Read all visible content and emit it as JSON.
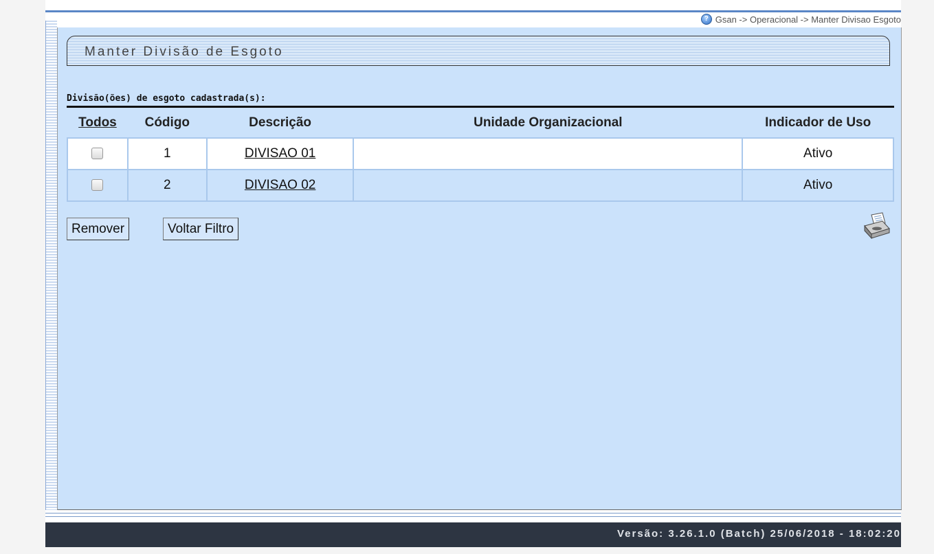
{
  "breadcrumb": "Gsan -> Operacional -> Manter Divisao Esgoto",
  "page_title": "Manter Divisão de Esgoto",
  "section_label": "Divisão(ões) de esgoto cadastrada(s):",
  "table": {
    "headers": {
      "todos": "Todos",
      "codigo": "Código",
      "descricao": "Descrição",
      "unidade": "Unidade Organizacional",
      "indicador": "Indicador de Uso"
    },
    "rows": [
      {
        "codigo": "1",
        "descricao": "DIVISAO 01",
        "unidade": "",
        "indicador": "Ativo",
        "checked": false
      },
      {
        "codigo": "2",
        "descricao": "DIVISAO 02",
        "unidade": "",
        "indicador": "Ativo",
        "checked": false
      }
    ]
  },
  "buttons": {
    "remover": "Remover",
    "voltar_filtro": "Voltar Filtro"
  },
  "icons": {
    "help": "help-icon",
    "print": "printer-icon"
  },
  "footer": "Versão: 3.26.1.0 (Batch) 25/06/2018 - 18:02:20",
  "colors": {
    "panel_bg": "#cbe2fb",
    "footer_bg": "#2d3542",
    "accent": "#5a86c6"
  }
}
